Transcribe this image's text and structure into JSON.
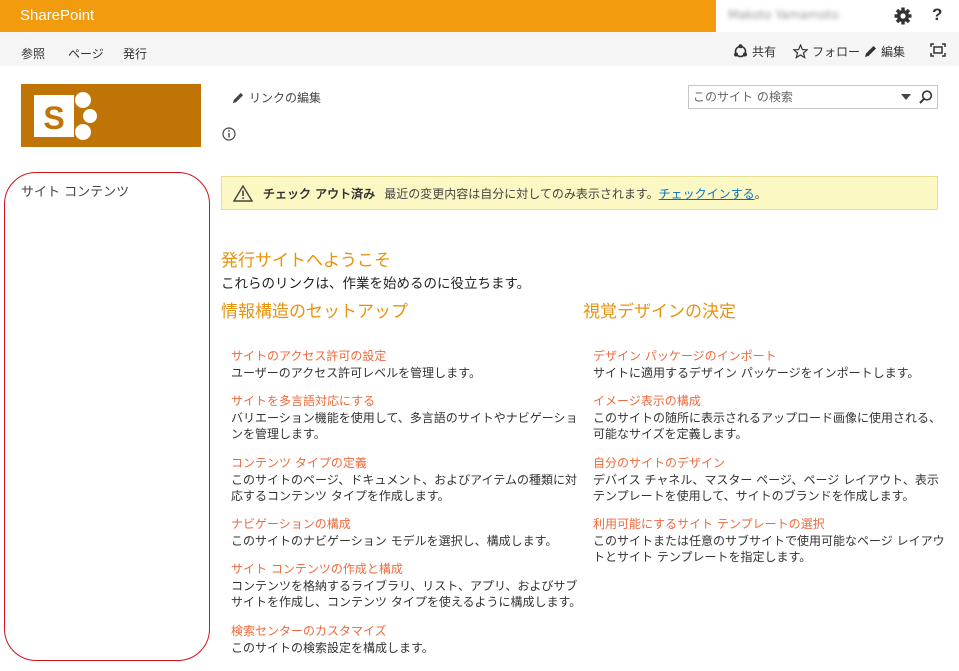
{
  "suitebar": {
    "brand": "SharePoint",
    "user": "Makoto Yamamoto",
    "help": "?"
  },
  "ribbon": {
    "tabs": [
      "参照",
      "ページ",
      "発行"
    ],
    "actions": {
      "share": "共有",
      "follow": "フォロー",
      "edit": "編集"
    }
  },
  "page": {
    "edit_links": "リンクの編集",
    "search_placeholder": "このサイト の検索",
    "left_nav_item": "サイト コンテンツ"
  },
  "status": {
    "title": "チェック アウト済み",
    "message": "最近の変更内容は自分に対してのみ表示されます。",
    "link": "チェックインする",
    "period": "。"
  },
  "content": {
    "welcome": "発行サイトへようこそ",
    "intro": "これらのリンクは、作業を始めるのに役立ちます。",
    "left_title": "情報構造のセットアップ",
    "right_title": "視覚デザインの決定",
    "left_items": [
      {
        "title": "サイトのアクセス許可の設定",
        "desc": "ユーザーのアクセス許可レベルを管理します。"
      },
      {
        "title": "サイトを多言語対応にする",
        "desc": "バリエーション機能を使用して、多言語のサイトやナビゲーションを管理します。"
      },
      {
        "title": "コンテンツ タイプの定義",
        "desc": "このサイトのページ、ドキュメント、およびアイテムの種類に対応するコンテンツ タイプを作成します。"
      },
      {
        "title": "ナビゲーションの構成",
        "desc": "このサイトのナビゲーション モデルを選択し、構成します。"
      },
      {
        "title": "サイト コンテンツの作成と構成",
        "desc": "コンテンツを格納するライブラリ、リスト、アプリ、およびサブサイトを作成し、コンテンツ タイプを使えるように構成します。"
      },
      {
        "title": "検索センターのカスタマイズ",
        "desc": "このサイトの検索設定を構成します。"
      }
    ],
    "right_items": [
      {
        "title": "デザイン パッケージのインポート",
        "desc": "サイトに適用するデザイン パッケージをインポートします。"
      },
      {
        "title": "イメージ表示の構成",
        "desc": "このサイトの随所に表示されるアップロード画像に使用される、可能なサイズを定義します。"
      },
      {
        "title": "自分のサイトのデザイン",
        "desc": "デバイス チャネル、マスター ページ、ページ レイアウト、表示テンプレートを使用して、サイトのブランドを作成します。"
      },
      {
        "title": "利用可能にするサイト テンプレートの選択",
        "desc": "このサイトまたは任意のサブサイトで使用可能なページ レイアウトとサイト テンプレートを指定します。"
      }
    ]
  },
  "colors": {
    "suitebar": "#f29b0c",
    "logo_bg": "#c07405",
    "heading": "#e8930e",
    "link_title": "#ee6a3c",
    "status_bg": "#fcf8c4",
    "annotation": "#d4101c"
  }
}
